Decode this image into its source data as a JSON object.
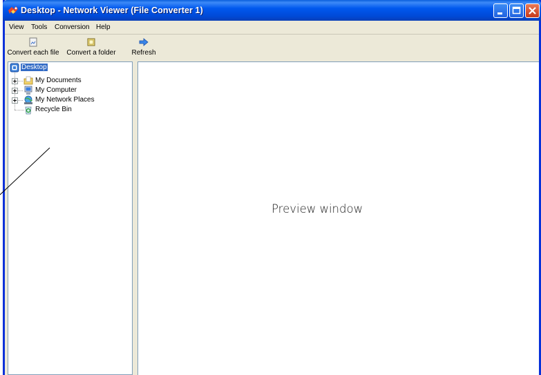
{
  "window": {
    "title": "Desktop - Network Viewer (File Converter 1)",
    "controls": [
      "minimize-icon",
      "maximize-icon",
      "close-icon"
    ]
  },
  "menu": {
    "items": [
      "View",
      "Tools",
      "Conversion",
      "Help"
    ]
  },
  "toolbar": {
    "buttons": [
      {
        "label": "Convert each file",
        "icon": "file-icon"
      },
      {
        "label": "Convert a folder",
        "icon": "folder-icon"
      },
      {
        "label": "Refresh",
        "icon": "refresh-arrow-icon"
      }
    ]
  },
  "tree": {
    "root": {
      "label": "Desktop",
      "icon": "desktop-icon",
      "selected": true
    },
    "children": [
      {
        "label": "My Documents",
        "icon": "documents-folder-icon",
        "expandable": true
      },
      {
        "label": "My Computer",
        "icon": "computer-icon",
        "expandable": true
      },
      {
        "label": "My Network Places",
        "icon": "network-places-icon",
        "expandable": true
      },
      {
        "label": "Recycle Bin",
        "icon": "recycle-bin-icon",
        "expandable": false
      }
    ]
  },
  "preview": {
    "label": "Preview window"
  },
  "colors": {
    "titlebar": "#0058ee",
    "chrome": "#ece9d8",
    "selection": "#316ac5",
    "pane_border": "#7f9db9"
  }
}
